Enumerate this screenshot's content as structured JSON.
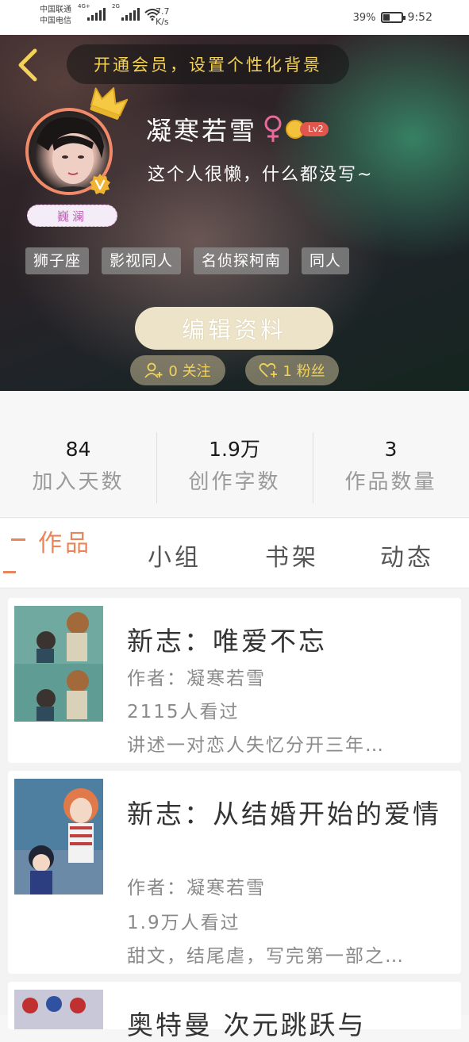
{
  "status_bar": {
    "carrier_1": "中国联通",
    "carrier_2": "中国电信",
    "net_1": "4G+",
    "net_2": "2G",
    "speed_value": "7.7",
    "speed_unit": "K/s",
    "battery_percent_text": "39%",
    "battery_level": 0.39,
    "time": "9:52"
  },
  "header": {
    "vip_banner": "开通会员，设置个性化背景",
    "username": "凝寒若雪",
    "level": "Lv2",
    "bio": "这个人很懒，什么都没写~",
    "nickname_badge": "巍澜",
    "tags": [
      "狮子座",
      "影视同人",
      "名侦探柯南",
      "同人"
    ],
    "edit_button": "编辑资料",
    "following": "0 关注",
    "fans": "1 粉丝"
  },
  "stats": [
    {
      "value": "84",
      "label": "加入天数"
    },
    {
      "value": "1.9万",
      "label": "创作字数"
    },
    {
      "value": "3",
      "label": "作品数量"
    }
  ],
  "tabs": [
    "作品",
    "小组",
    "书架",
    "动态"
  ],
  "works": [
    {
      "title": "新志：唯爱不忘",
      "author": "作者：凝寒若雪",
      "views": "2115人看过",
      "summary": "讲述一对恋人失忆分开三年…"
    },
    {
      "title": "新志：从结婚开始的爱情",
      "author": "作者：凝寒若雪",
      "views": "1.9万人看过",
      "summary": "甜文，结尾虐，写完第一部之…"
    },
    {
      "title": "奥特曼 次元跳跃与"
    }
  ],
  "icons": {
    "back": "chevron-left-icon",
    "crown": "crown-icon",
    "verified": "v-badge-icon",
    "female": "female-icon",
    "add_friend": "add-user-icon",
    "heart": "heart-plus-icon"
  },
  "colors": {
    "accent": "#e8855a",
    "gold": "#f3d25a",
    "edit_button_bg": "#ece3c8",
    "tag_bg": "#8c8c8c"
  }
}
